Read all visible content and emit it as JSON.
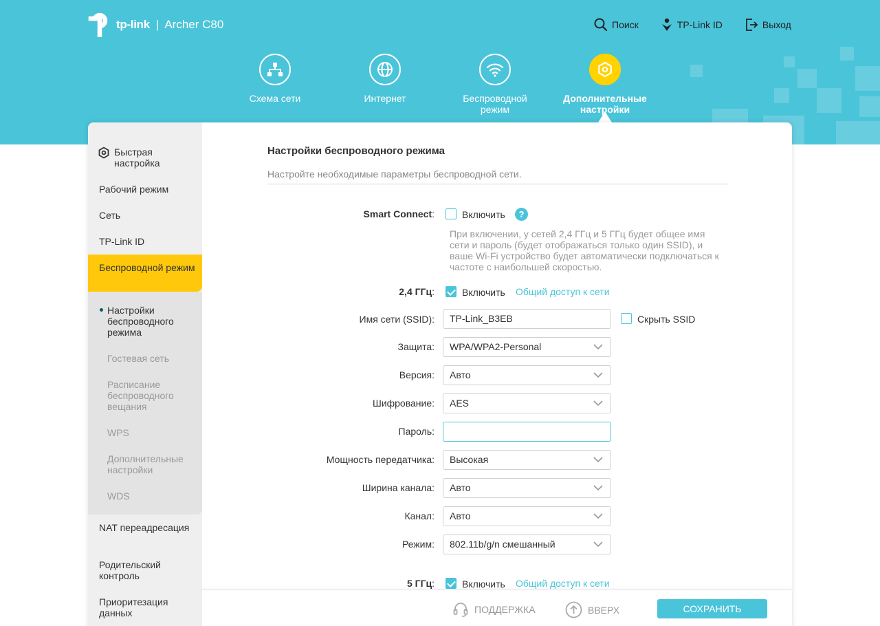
{
  "header": {
    "brand": "tp-link",
    "separator": "|",
    "model": "Archer C80",
    "links": [
      {
        "label": "Поиск",
        "icon": "search-icon"
      },
      {
        "label": "TP-Link ID",
        "icon": "tplink-id-icon"
      },
      {
        "label": "Выход",
        "icon": "logout-icon"
      }
    ],
    "tabs": [
      {
        "label": "Схема сети",
        "icon": "network-map-icon",
        "active": false
      },
      {
        "label": "Интернет",
        "icon": "globe-icon",
        "active": false
      },
      {
        "label": "Беспроводной режим",
        "icon": "wifi-icon",
        "active": false
      },
      {
        "label": "Дополнительные настройки",
        "icon": "gear-icon",
        "active": true
      }
    ],
    "colors": {
      "band": "#4ac4d9",
      "active_tab": "#ffd200"
    }
  },
  "sidebar": {
    "items": [
      {
        "label": "Быстрая настройка",
        "icon": "quick-setup-icon"
      },
      {
        "label": "Рабочий режим"
      },
      {
        "label": "Сеть"
      },
      {
        "label": "TP-Link ID"
      },
      {
        "label": "Беспроводной режим",
        "active": true
      },
      {
        "label": "NAT переадресация"
      },
      {
        "label": "Родительский контроль"
      },
      {
        "label": "Приоритезация данных"
      }
    ],
    "subitems": [
      {
        "label": "Настройки беспроводного режима",
        "current": true
      },
      {
        "label": "Гостевая сеть"
      },
      {
        "label": "Расписание беспроводного вещания"
      },
      {
        "label": "WPS"
      },
      {
        "label": "Дополнительные настройки"
      },
      {
        "label": "WDS"
      }
    ],
    "colors": {
      "active": "#ffc80a"
    }
  },
  "main": {
    "title": "Настройки беспроводного режима",
    "subtitle": "Настройте необходимые параметры беспроводной сети.",
    "smart_connect": {
      "label": "Smart Connect",
      "colon": ":",
      "enable_label": "Включить",
      "checked": false,
      "help": "?",
      "note": "При включении, у сетей 2,4 ГГц и 5 ГГц будет общее имя сети и пароль (будет отображаться только один SSID), и ваше Wi-Fi устройство будет автоматически подключаться к частоте с наибольшей скоростью."
    },
    "band24": {
      "label": "2,4 ГГц",
      "colon": ":",
      "enable_label": "Включить",
      "checked": true,
      "share_link": "Общий доступ к сети"
    },
    "fields": [
      {
        "label": "Имя сети (SSID):",
        "value": "TP-Link_B3EB",
        "type": "text"
      },
      {
        "label": "Защита:",
        "value": "WPA/WPA2-Personal",
        "type": "select"
      },
      {
        "label": "Версия:",
        "value": "Авто",
        "type": "select"
      },
      {
        "label": "Шифрование:",
        "value": "AES",
        "type": "select"
      },
      {
        "label": "Пароль:",
        "value": "",
        "type": "password"
      },
      {
        "label": "Мощность передатчика:",
        "value": "Высокая",
        "type": "select"
      },
      {
        "label": "Ширина канала:",
        "value": "Авто",
        "type": "select"
      },
      {
        "label": "Канал:",
        "value": "Авто",
        "type": "select"
      },
      {
        "label": "Режим:",
        "value": "802.11b/g/n смешанный",
        "type": "select"
      }
    ],
    "hide_ssid": {
      "label": "Скрыть SSID",
      "checked": false
    },
    "band5": {
      "label": "5 ГГц",
      "colon": ":",
      "enable_label": "Включить",
      "checked": true,
      "share_link": "Общий доступ к сети"
    }
  },
  "footer": {
    "support": "ПОДДЕРЖКА",
    "up": "ВВЕРХ",
    "save": "СОХРАНИТЬ"
  }
}
